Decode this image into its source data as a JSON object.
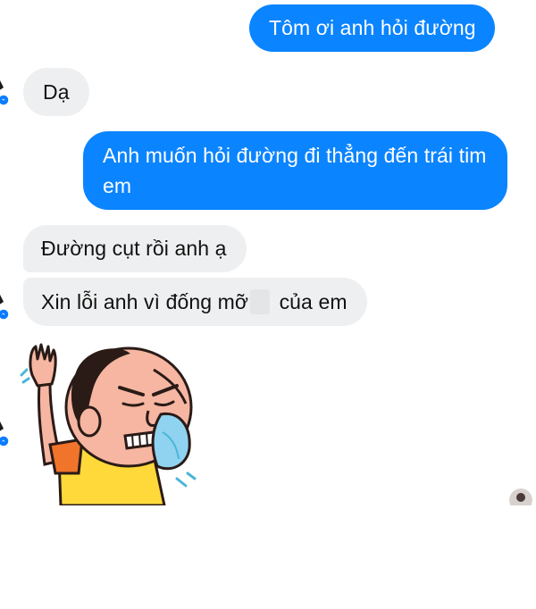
{
  "conversation": {
    "messages": [
      {
        "sender": "me",
        "text": "Tôm ơi anh hỏi đường"
      },
      {
        "sender": "them",
        "text": "Dạ"
      },
      {
        "sender": "me",
        "text": "Anh muốn hỏi đường đi thẳng đến trái tim em"
      },
      {
        "sender": "them",
        "text": "Đường cụt rồi anh ạ"
      },
      {
        "sender": "them",
        "text_before": "Xin lỗi anh vì đống mỡ",
        "text_after": " của em"
      }
    ],
    "sticker": {
      "description_icon": "crying-man-sticker-icon"
    }
  },
  "colors": {
    "outgoing_bubble": "#0b84ff",
    "incoming_bubble": "#eeeff0",
    "messenger_badge": "#0a7cff",
    "background": "#ffffff"
  },
  "icons": {
    "contact_avatar": "avatar-icon",
    "messenger_badge": "messenger-badge-icon",
    "seen_indicator": "seen-avatar-icon"
  }
}
